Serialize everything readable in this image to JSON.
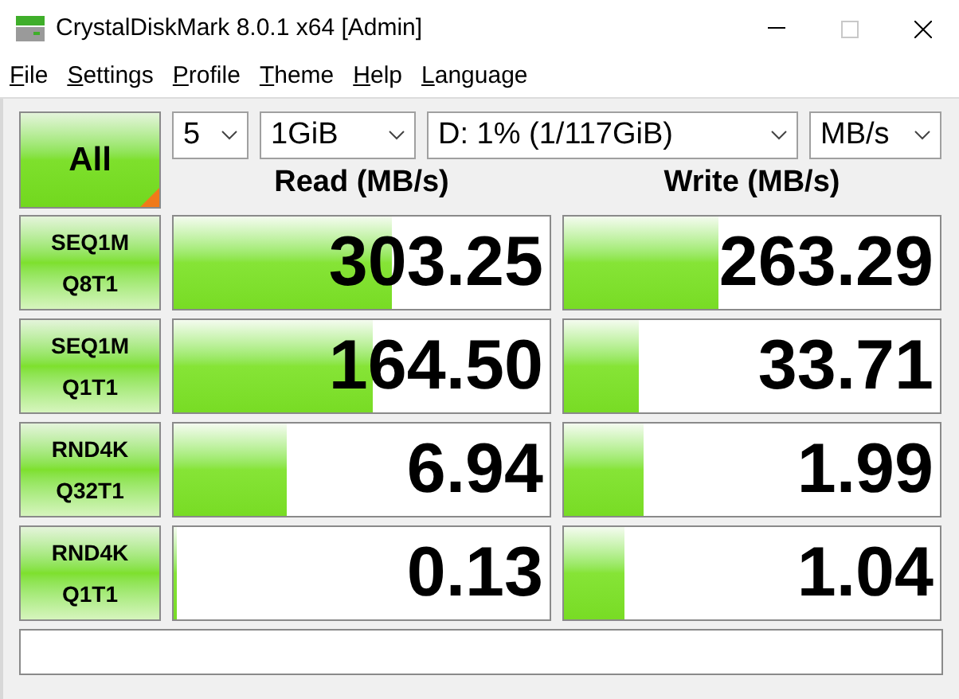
{
  "window": {
    "title": "CrystalDiskMark 8.0.1 x64 [Admin]",
    "maximize_disabled": true
  },
  "menu": [
    "File",
    "Settings",
    "Profile",
    "Theme",
    "Help",
    "Language"
  ],
  "all_button": {
    "label": "All"
  },
  "selectors": [
    {
      "value": "5"
    },
    {
      "value": "1GiB"
    },
    {
      "value": "D: 1% (1/117GiB)"
    },
    {
      "value": "MB/s"
    }
  ],
  "columns": [
    "Read (MB/s)",
    "Write (MB/s)"
  ],
  "tests": [
    {
      "line1": "SEQ1M",
      "line2": "Q8T1",
      "read": {
        "value": "303.25",
        "level": 0.58
      },
      "write": {
        "value": "263.29",
        "level": 0.41
      }
    },
    {
      "line1": "SEQ1M",
      "line2": "Q1T1",
      "read": {
        "value": "164.50",
        "level": 0.53
      },
      "write": {
        "value": "33.71",
        "level": 0.2
      }
    },
    {
      "line1": "RND4K",
      "line2": "Q32T1",
      "read": {
        "value": "6.94",
        "level": 0.3
      },
      "write": {
        "value": "1.99",
        "level": 0.21
      }
    },
    {
      "line1": "RND4K",
      "line2": "Q1T1",
      "read": {
        "value": "0.13",
        "level": 0.01
      },
      "write": {
        "value": "1.04",
        "level": 0.16
      }
    }
  ]
}
